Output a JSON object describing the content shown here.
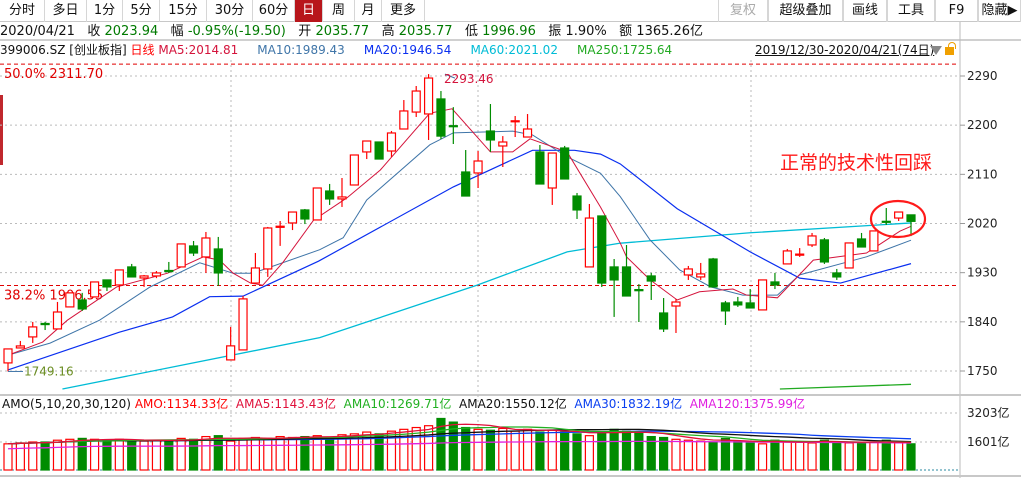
{
  "toolbar": {
    "left": [
      "分时",
      "多日",
      "1分",
      "5分",
      "15分",
      "30分",
      "60分",
      "日",
      "周",
      "月",
      "更多"
    ],
    "active": "日",
    "right": [
      "复权",
      "超级叠加",
      "画线",
      "工具",
      "F9",
      "隐藏▶"
    ]
  },
  "info": {
    "date": "2020/04/21",
    "close_label": "收",
    "close": "2023.94",
    "change_label": "幅",
    "change": "-0.95%(-19.50)",
    "open_label": "开",
    "open": "2035.77",
    "high_label": "高",
    "high": "2035.77",
    "low_label": "低",
    "low": "1996.96",
    "amp_label": "振",
    "amp": "1.90%",
    "amount_label": "额",
    "amount": "1365.26亿"
  },
  "ma": {
    "code": "399006.SZ",
    "name": "[创业板指]",
    "period": "日线",
    "ma5": "MA5:2014.81",
    "ma10": "MA10:1989.43",
    "ma20": "MA20:1946.54",
    "ma60": "MA60:2021.02",
    "ma250": "MA250:1725.64"
  },
  "range": "2019/12/30-2020/04/21(74日)",
  "annotation": "正常的技术性回踩",
  "colors": {
    "up": "#ff0000",
    "down": "#008c00",
    "ma5": "#d4143c",
    "ma10": "#3f75a8",
    "ma20": "#0a2ff0",
    "ma60": "#00bcd6",
    "ma250": "#22aa22",
    "fib": "#e00000"
  },
  "amo": {
    "title": "AMO(5,10,20,30,120)",
    "amo": "AMO:1134.33亿",
    "ama5": "AMA5:1143.43亿",
    "ama10": "AMA10:1269.71亿",
    "ama20": "AMA20:1550.12亿",
    "ama30": "AMA30:1832.19亿",
    "ama120": "AMA120:1375.99亿",
    "ticks": [
      "3203亿",
      "1601亿"
    ]
  },
  "chart_data": {
    "type": "candlestick",
    "price_ticks": [
      2290,
      2200,
      2110,
      2020,
      1930,
      1840,
      1750
    ],
    "price_tick_labels": [
      "2290",
      "2200",
      "2110",
      "2020",
      "1930",
      "1840",
      "1750"
    ],
    "fib": [
      {
        "label": "50.0%  2311.70",
        "value": 2311.7
      },
      {
        "label": "38.2%  1906.55",
        "value": 1906.55
      }
    ],
    "high_mark": {
      "label": "2293.46",
      "index": 35,
      "value": 2293.46
    },
    "low_mark": {
      "label": "1749.16",
      "index": 0,
      "value": 1749.16
    },
    "candles": [
      [
        1764.8,
        1790.4,
        1749.2,
        1790.4
      ],
      [
        1792.2,
        1805,
        1792,
        1795.9
      ],
      [
        1812.4,
        1839.8,
        1801.4,
        1830.7
      ],
      [
        1837,
        1840,
        1825,
        1835
      ],
      [
        1827,
        1876.4,
        1827,
        1858
      ],
      [
        1867.3,
        1893,
        1867,
        1893
      ],
      [
        1880,
        1893,
        1860,
        1863.6
      ],
      [
        1885.6,
        1913,
        1885,
        1913
      ],
      [
        1916.7,
        1917,
        1896.5,
        1903.9
      ],
      [
        1907.5,
        1935,
        1896.5,
        1935
      ],
      [
        1940.5,
        1946,
        1922,
        1922.2
      ],
      [
        1920.3,
        1925.8,
        1904,
        1924
      ],
      [
        1924,
        1933,
        1920,
        1929.5
      ],
      [
        1934,
        1949.6,
        1929.5,
        1932
      ],
      [
        1940.5,
        1983,
        1940,
        1982.6
      ],
      [
        1978.9,
        1988,
        1960.6,
        1966
      ],
      [
        1958.8,
        2004.5,
        1929.5,
        1993.5
      ],
      [
        1973.4,
        1995.4,
        1905.7,
        1929.5
      ],
      [
        1770.3,
        1830.7,
        1770,
        1796
      ],
      [
        1788.6,
        1887.4,
        1788,
        1882
      ],
      [
        1911,
        1966,
        1911,
        1938.6
      ],
      [
        1936.8,
        2013.7,
        1922.2,
        2011.8
      ],
      [
        2013,
        2024.6,
        1979,
        2015
      ],
      [
        2021,
        2041,
        2008,
        2041
      ],
      [
        2044.8,
        2046.6,
        2019,
        2028.3
      ],
      [
        2026.5,
        2085,
        2026,
        2085
      ],
      [
        2079.5,
        2092.4,
        2054,
        2064.9
      ],
      [
        2065,
        2103.3,
        2050.3,
        2068.6
      ],
      [
        2090.5,
        2145.4,
        2090,
        2145.4
      ],
      [
        2151,
        2171,
        2138,
        2171
      ],
      [
        2169.2,
        2170,
        2138,
        2138
      ],
      [
        2152.7,
        2189.4,
        2141.8,
        2185.7
      ],
      [
        2193,
        2246,
        2193,
        2226
      ],
      [
        2224,
        2271.7,
        2215,
        2262.5
      ],
      [
        2220.5,
        2293.46,
        2172.9,
        2286.3
      ],
      [
        2248,
        2262.5,
        2174.7,
        2180
      ],
      [
        2199,
        2233,
        2165.5,
        2198
      ],
      [
        2114.3,
        2154.5,
        2070,
        2070.3
      ],
      [
        2112.5,
        2152.7,
        2085,
        2134.4
      ],
      [
        2189.3,
        2238.7,
        2151,
        2172.9
      ],
      [
        2161.9,
        2180,
        2123.4,
        2169.2
      ],
      [
        2207,
        2216.8,
        2178.3,
        2208
      ],
      [
        2178.3,
        2220.4,
        2178,
        2193
      ],
      [
        2151,
        2163.7,
        2092,
        2092.3
      ],
      [
        2085,
        2150,
        2054,
        2149
      ],
      [
        2158.2,
        2162,
        2101,
        2101.5
      ],
      [
        2070.3,
        2075.9,
        2028.3,
        2044.8
      ],
      [
        1940.5,
        2055.7,
        1940,
        2030
      ],
      [
        2033.8,
        2034,
        1903.8,
        1911
      ],
      [
        1940.5,
        1955,
        1849,
        1916.7
      ],
      [
        1940.5,
        1980.6,
        1887,
        1887.3
      ],
      [
        1899,
        1909,
        1839.7,
        1897
      ],
      [
        1924,
        1929.5,
        1880,
        1914.7
      ],
      [
        1856.2,
        1883.6,
        1821.4,
        1827
      ],
      [
        1869,
        1882,
        1819.6,
        1876.3
      ],
      [
        1925.8,
        1942.3,
        1916.7,
        1936.8
      ],
      [
        1922.2,
        1947.8,
        1916.7,
        1927.7
      ],
      [
        1955,
        1957,
        1903,
        1903.9
      ],
      [
        1874.6,
        1878.3,
        1834.3,
        1860
      ],
      [
        1876.3,
        1885.6,
        1867.3,
        1871
      ],
      [
        1874.6,
        1900,
        1865,
        1865.4
      ],
      [
        1861.8,
        1917,
        1861,
        1916.7
      ],
      [
        1913,
        1929.5,
        1900,
        1907.5
      ],
      [
        1946,
        1973.4,
        1946,
        1969.8
      ],
      [
        1962,
        1975,
        1958.8,
        1964
      ],
      [
        1980.7,
        2002.7,
        1977,
        1997.2
      ],
      [
        1990,
        1993.5,
        1946,
        1949.6
      ],
      [
        1929.5,
        1936.8,
        1916.7,
        1922.2
      ],
      [
        1938.6,
        1985,
        1938,
        1984.4
      ],
      [
        1991.7,
        2002.7,
        1977,
        1977
      ],
      [
        1969.8,
        2007,
        1970,
        2006.4
      ],
      [
        2024,
        2048.4,
        2017.3,
        2023
      ],
      [
        2030,
        2041,
        2024.6,
        2041
      ],
      [
        2035.77,
        2035.77,
        1996.96,
        2023.94
      ]
    ],
    "ma_series": {
      "ma5": [
        [
          0,
          1779
        ],
        [
          2.8,
          1803
        ],
        [
          4.8,
          1843
        ],
        [
          8.8,
          1904
        ],
        [
          12.9,
          1929
        ],
        [
          15.8,
          1959
        ],
        [
          17.1,
          1953
        ],
        [
          18.2,
          1929
        ],
        [
          19.6,
          1911
        ],
        [
          20.6,
          1907
        ],
        [
          22.2,
          1948
        ],
        [
          24.7,
          2026
        ],
        [
          27.4,
          2067
        ],
        [
          30.1,
          2118
        ],
        [
          34.1,
          2222
        ],
        [
          35.9,
          2230
        ],
        [
          39,
          2151
        ],
        [
          40.8,
          2151
        ],
        [
          42.2,
          2175
        ],
        [
          45.2,
          2151
        ],
        [
          47.9,
          2050
        ],
        [
          49.5,
          1984
        ],
        [
          50,
          1959
        ],
        [
          51.9,
          1917
        ],
        [
          54.1,
          1880
        ],
        [
          55.9,
          1895
        ],
        [
          58.6,
          1900
        ],
        [
          59.7,
          1889
        ],
        [
          62.2,
          1884
        ],
        [
          65.1,
          1953
        ],
        [
          69.4,
          1966
        ],
        [
          72.1,
          2006
        ],
        [
          73,
          2014.81
        ]
      ],
      "ma10": [
        [
          0,
          1779
        ],
        [
          3.4,
          1801
        ],
        [
          7.4,
          1843
        ],
        [
          11.5,
          1904
        ],
        [
          15.5,
          1948
        ],
        [
          18.2,
          1929
        ],
        [
          19.8,
          1929
        ],
        [
          25.2,
          1972
        ],
        [
          27.1,
          1994
        ],
        [
          29,
          2063
        ],
        [
          34.1,
          2164
        ],
        [
          36,
          2186
        ],
        [
          40.8,
          2189
        ],
        [
          42.4,
          2182
        ],
        [
          45.2,
          2142
        ],
        [
          47.9,
          2112
        ],
        [
          49.5,
          2069
        ],
        [
          51.9,
          1990
        ],
        [
          54.3,
          1935
        ],
        [
          56.8,
          1904
        ],
        [
          59.4,
          1889
        ],
        [
          62.2,
          1889
        ],
        [
          64,
          1926
        ],
        [
          69.4,
          1959
        ],
        [
          73,
          1989.43
        ]
      ],
      "ma20": [
        [
          0,
          1752
        ],
        [
          9,
          1821
        ],
        [
          13.3,
          1849
        ],
        [
          16.3,
          1886
        ],
        [
          19,
          1887
        ],
        [
          25.1,
          1951
        ],
        [
          36,
          2087
        ],
        [
          42.4,
          2154
        ],
        [
          45.8,
          2154
        ],
        [
          47.9,
          2147
        ],
        [
          49.5,
          2129
        ],
        [
          54.1,
          2047
        ],
        [
          60,
          1968
        ],
        [
          64,
          1920
        ],
        [
          67.3,
          1911
        ],
        [
          73,
          1946.54
        ]
      ],
      "ma60": [
        [
          4.4,
          1717
        ],
        [
          25.2,
          1811
        ],
        [
          37.9,
          1907
        ],
        [
          45.2,
          1968
        ],
        [
          49.5,
          1984
        ],
        [
          60,
          2003
        ],
        [
          73,
          2021.02
        ]
      ],
      "ma250": [
        [
          62.4,
          1717
        ],
        [
          73,
          1725.64
        ]
      ]
    },
    "volume": [
      1500,
      1550,
      1600,
      1600,
      1700,
      1750,
      1800,
      1750,
      1700,
      1750,
      1700,
      1650,
      1700,
      1650,
      1800,
      1750,
      1900,
      1950,
      1650,
      1800,
      1850,
      1800,
      1900,
      1850,
      1900,
      1950,
      1850,
      2000,
      2050,
      2150,
      2050,
      2200,
      2300,
      2400,
      2500,
      2900,
      2700,
      2400,
      2300,
      2250,
      2350,
      2200,
      2300,
      2150,
      2250,
      2150,
      2050,
      1950,
      2150,
      2300,
      2200,
      2100,
      1900,
      1850,
      1750,
      1700,
      1650,
      1600,
      1800,
      1650,
      1550,
      1500,
      1700,
      1650,
      1600,
      1550,
      1700,
      1600,
      1550,
      1550,
      1600,
      1700,
      1550,
      1500
    ],
    "volume_ticks": [
      3203,
      1601
    ]
  }
}
